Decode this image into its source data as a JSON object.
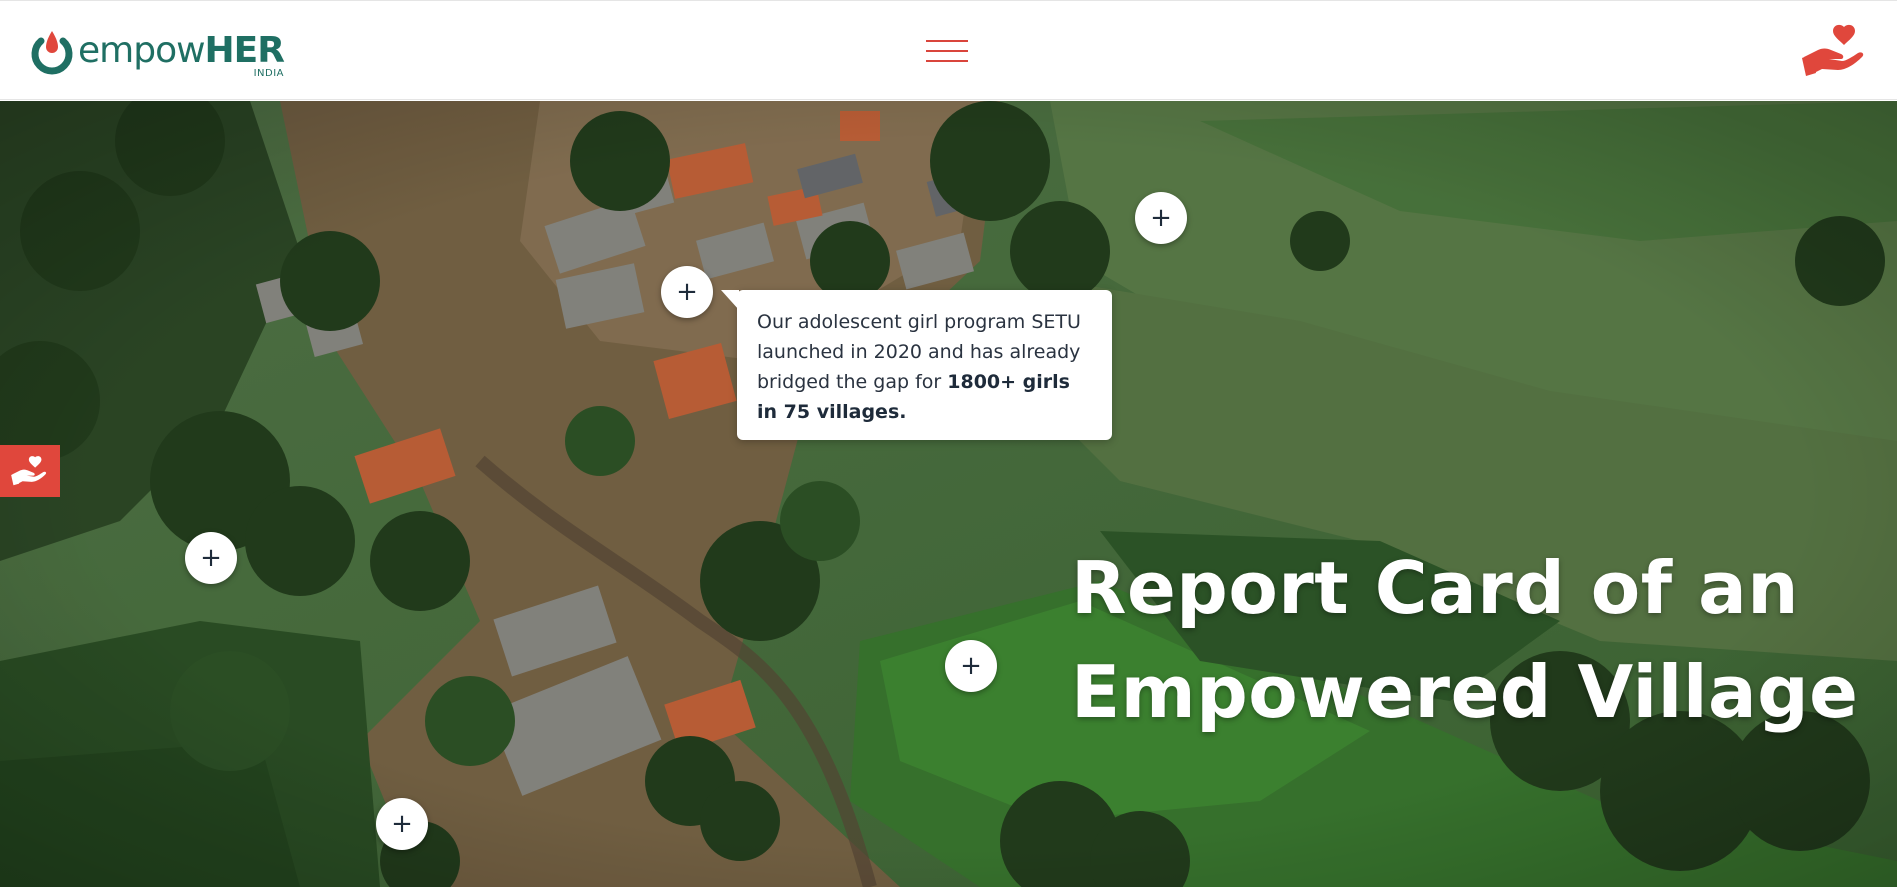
{
  "brand": {
    "name_light": "empow",
    "name_bold": "HER",
    "name_sub": "INDIA",
    "primary_color": "#1f6f63",
    "accent_color": "#d9453c"
  },
  "header": {
    "menu_icon": "hamburger-menu-icon",
    "donate_icon": "heart-in-hand-icon"
  },
  "hero": {
    "title_line1": "Report Card of an",
    "title_line2": "Empowered Village",
    "hotspot_symbol": "+"
  },
  "tooltip": {
    "text_1": "Our adolescent girl program SETU launched in 2020 and has already bridged the gap for ",
    "text_bold": "1800+ girls in 75 villages."
  },
  "side_tab": {
    "icon": "heart-in-hand-icon"
  }
}
